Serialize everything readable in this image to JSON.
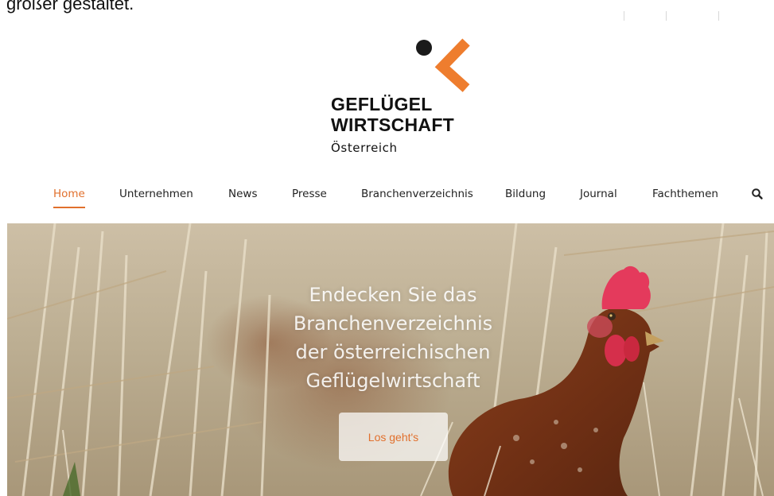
{
  "top_snippet": "größer gestaltet.",
  "logo": {
    "line1": "GEFLÜGEL",
    "line2": "WIRTSCHAFT",
    "line3": "Österreich",
    "colors": {
      "accent": "#ee7d2e",
      "dot": "#1a1a1a"
    }
  },
  "nav": {
    "items": [
      {
        "label": "Home",
        "active": true
      },
      {
        "label": "Unternehmen",
        "active": false
      },
      {
        "label": "News",
        "active": false
      },
      {
        "label": "Presse",
        "active": false
      },
      {
        "label": "Branchenverzeichnis",
        "active": false
      },
      {
        "label": "Bildung",
        "active": false
      },
      {
        "label": "Journal",
        "active": false
      },
      {
        "label": "Fachthemen",
        "active": false
      }
    ],
    "search_icon": "search-icon",
    "active_color": "#e1702d"
  },
  "hero": {
    "title_lines": [
      "Endecken Sie das",
      "Branchenverzeichnis",
      "der österreichischen",
      "Geflügelwirtschaft"
    ],
    "cta_label": "Los geht's",
    "image": "brown hen in dry grass"
  }
}
